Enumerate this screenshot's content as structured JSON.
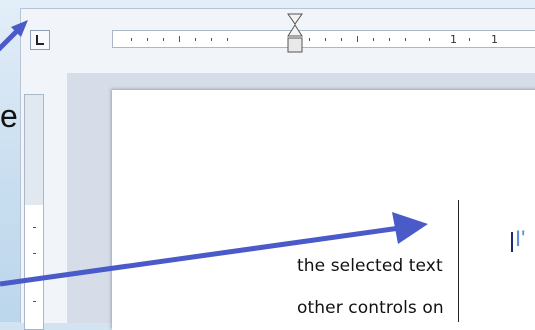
{
  "left_text": "e",
  "horizontal_ruler": {
    "labels": [
      "1",
      "1"
    ]
  },
  "document": {
    "heading_fragment": "I'",
    "lines": [
      "the selected text",
      "other controls on"
    ]
  },
  "icons": {
    "tab_selector": "left-tab-stop-icon",
    "indent": "indent-marker-icon"
  },
  "colors": {
    "arrow": "#4a5ac8",
    "background": "#d2e4f2"
  }
}
